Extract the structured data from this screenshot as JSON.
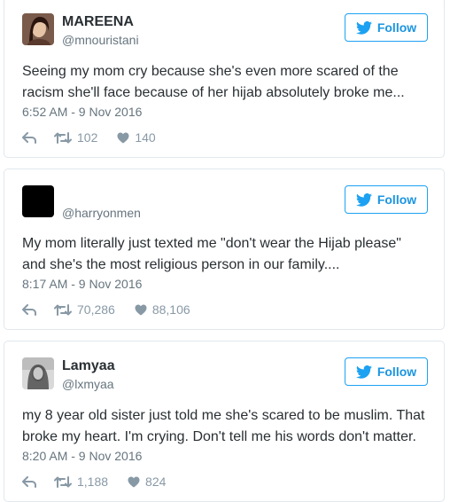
{
  "follow_label": "Follow",
  "tweets": [
    {
      "name": "MAREENA",
      "handle": "@mnouristani",
      "line1": "Seeing my mom cry because she's even more scared of the",
      "line2": "racism she'll face because of her hijab absolutely broke me...",
      "date": "6:52 AM - 9 Nov 2016",
      "retweets": "102",
      "likes": "140"
    },
    {
      "name": "",
      "handle": "@harryonmen",
      "line1": "My mom literally just texted me \"don't wear the Hijab please\"",
      "line2": "and she's the most religious person in our family....",
      "date": "8:17 AM - 9 Nov 2016",
      "retweets": "70,286",
      "likes": "88,106"
    },
    {
      "name": "Lamyaa",
      "handle": "@lxmyaa",
      "line1": "my 8 year old sister just told me she's scared to be muslim. That",
      "line2": "broke my heart. I'm crying. Don't tell me his words don't matter.",
      "date": "8:20 AM - 9 Nov 2016",
      "retweets": "1,188",
      "likes": "824"
    }
  ],
  "colors": {
    "brand": "#1da1f2",
    "text": "#292f33",
    "muted": "#66757f",
    "icon": "#8899a6"
  }
}
